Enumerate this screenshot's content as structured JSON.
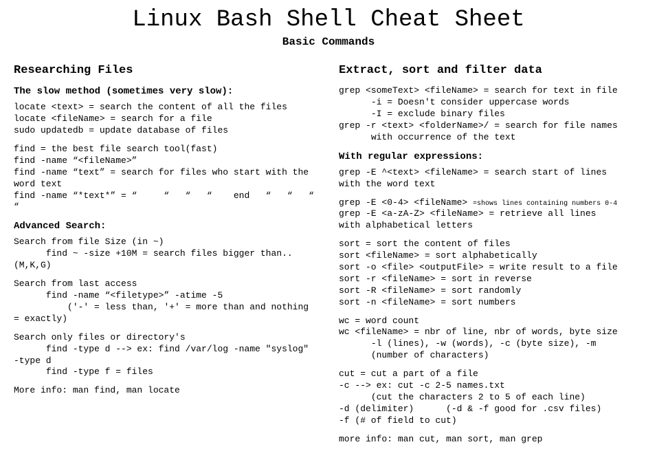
{
  "title": "Linux Bash Shell Cheat Sheet",
  "subtitle": "Basic Commands",
  "left": {
    "heading": "Researching Files",
    "sub1": "The slow method (sometimes very slow):",
    "block1": "locate <text> = search the content of all the files\nlocate <fileName> = search for a file\nsudo updatedb = update database of files",
    "block2": "find = the best file search tool(fast)\nfind -name “<fileName>”\nfind -name “text” = search for files who start with the word text\nfind -name “*text*” = “     “   “   “    end   “   “   “   “",
    "sub2": "Advanced Search:",
    "block3": "Search from file Size (in ~)\n      find ~ -size +10M = search files bigger than.. (M,K,G)",
    "block4": "Search from last access\n      find -name “<filetype>” -atime -5\n          ('-' = less than, '+' = more than and nothing = exactly)",
    "block5": "Search only files or directory's\n      find -type d --> ex: find /var/log -name \"syslog\" -type d\n      find -type f = files",
    "block6": "More info: man find, man locate"
  },
  "right": {
    "heading": "Extract, sort and filter data",
    "block1": "grep <someText> <fileName> = search for text in file\n      -i = Doesn't consider uppercase words\n      -I = exclude binary files\ngrep -r <text> <folderName>/ = search for file names\n      with occurrence of the text",
    "sub1": "With regular expressions:",
    "block2a": "grep -E ^<text> <fileName> = search start of lines\nwith the word text",
    "block2b_prefix": "grep -E <0-4> <fileName> ",
    "block2b_small": "=shows lines containing numbers 0-4",
    "block2c": "grep -E <a-zA-Z> <fileName> = retrieve all lines\nwith alphabetical letters",
    "block3": "sort = sort the content of files\nsort <fileName> = sort alphabetically\nsort -o <file> <outputFile> = write result to a file\nsort -r <fileName> = sort in reverse\nsort -R <fileName> = sort randomly\nsort -n <fileName> = sort numbers",
    "block4": "wc = word count\nwc <fileName> = nbr of line, nbr of words, byte size\n      -l (lines), -w (words), -c (byte size), -m\n      (number of characters)",
    "block5": "cut = cut a part of a file\n-c --> ex: cut -c 2-5 names.txt\n      (cut the characters 2 to 5 of each line)\n-d (delimiter)      (-d & -f good for .csv files)\n-f (# of field to cut)",
    "block6": "more info: man cut, man sort, man grep"
  }
}
